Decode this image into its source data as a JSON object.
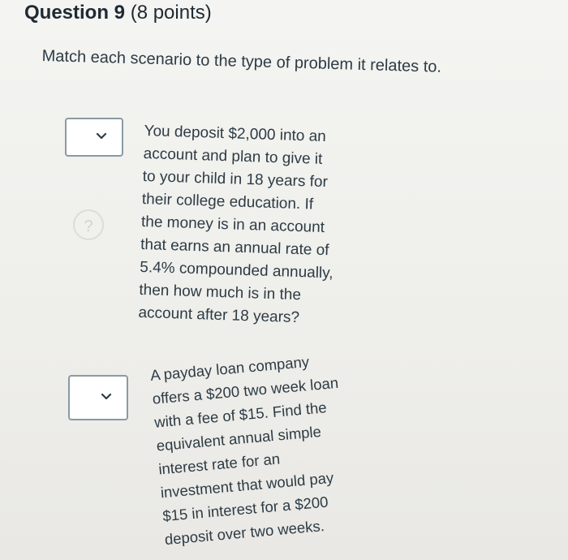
{
  "question": {
    "title": "Question 9",
    "points": "(8 points)"
  },
  "instructions": "Match each scenario to the type of problem it relates to.",
  "items": [
    {
      "select_value": "",
      "text": "You deposit $2,000 into an\naccount and plan to give it\nto your child in 18 years for\ntheir college education. If\nthe money is in an account\nthat earns an annual rate of\n5.4% compounded annually,\nthen how much is in the\naccount after 18 years?"
    },
    {
      "select_value": "",
      "text": "A payday loan company\noffers a $200 two week loan\nwith a fee of $15. Find the\nequivalent annual simple\ninterest rate for an\ninvestment that would pay\n$15 in interest for a $200\ndeposit over two weeks."
    }
  ],
  "icons": {
    "dropdown": "chevron-down-icon"
  },
  "colors": {
    "text": "#2d3b45",
    "select_border": "#8a9aa5",
    "background": "#f4f4f2"
  }
}
